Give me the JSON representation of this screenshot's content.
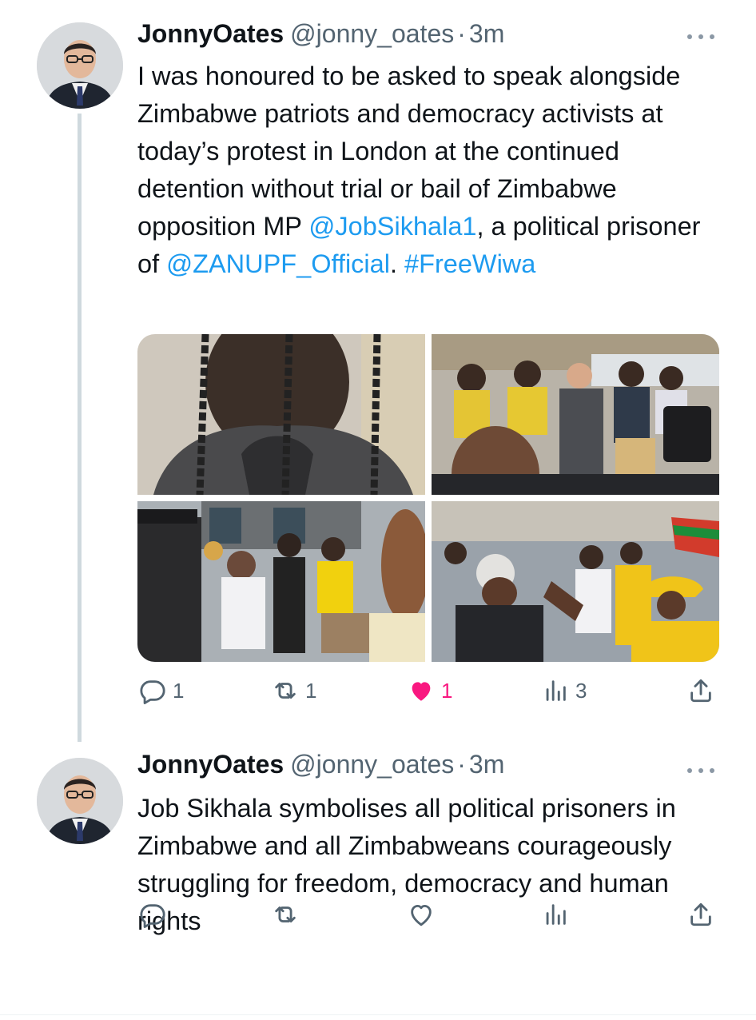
{
  "tweets": [
    {
      "name": "JonnyOates",
      "handle": "@jonny_oates",
      "separator": "·",
      "time": "3m",
      "text_parts": [
        {
          "t": "I was honoured to be asked to speak alongside Zimbabwe patriots and democracy activists at today’s protest in London at the continued detention without trial or bail of Zimbabwe opposition MP ",
          "link": false
        },
        {
          "t": "@JobSikhala1",
          "link": true
        },
        {
          "t": ", a political prisoner of ",
          "link": false
        },
        {
          "t": "@ZANUPF_Official",
          "link": true
        },
        {
          "t": ". ",
          "link": false
        },
        {
          "t": "#FreeWiwa",
          "link": true
        }
      ],
      "media": [
        "photo-prisoner-behind-bars",
        "photo-protest-crowd-speaker",
        "photo-protest-street-group",
        "photo-protest-flags-crowd"
      ],
      "actions": {
        "reply": "1",
        "retweet": "1",
        "like": "1",
        "views": "3"
      },
      "liked": true
    },
    {
      "name": "JonnyOates",
      "handle": "@jonny_oates",
      "separator": "·",
      "time": "3m",
      "text": "Job Sikhala symbolises all political prisoners in Zimbabwe and all Zimbabweans courageously struggling for freedom, democracy and human rights",
      "actions": {
        "reply": "",
        "retweet": "",
        "like": "",
        "views": ""
      },
      "liked": false
    }
  ],
  "icons": {
    "reply": "reply-icon",
    "retweet": "retweet-icon",
    "like": "heart-icon",
    "views": "views-icon",
    "share": "share-icon",
    "more": "more-icon"
  },
  "colors": {
    "link": "#1d9bf0",
    "like_active": "#f91880",
    "secondary_text": "#536471",
    "thread_line": "#cfd9de"
  }
}
